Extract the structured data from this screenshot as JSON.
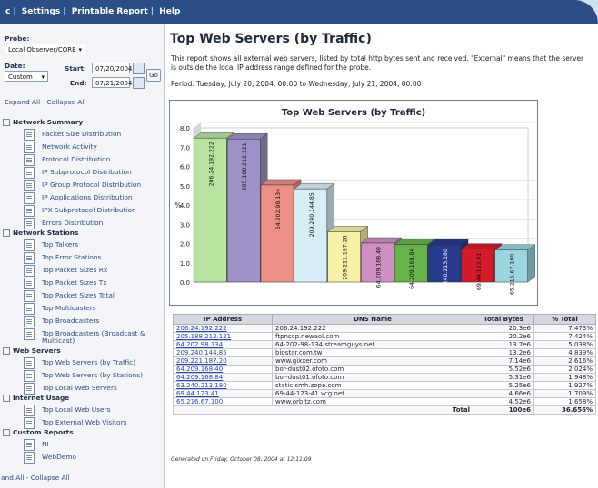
{
  "topbar": {
    "links": [
      "c",
      "Settings",
      "Printable Report",
      "Help"
    ]
  },
  "sidebar": {
    "probe_label": "Probe:",
    "probe_value": "Local Observer/CORE",
    "date_label": "Date:",
    "date_value": "Custom",
    "start_label": "Start:",
    "start_value": "07/20/2004",
    "end_label": "End:",
    "end_value": "07/21/2004",
    "go_label": "Go",
    "expand_collapse": "Expand All - Collapse All",
    "expand_collapse_bottom": "and All - Collapse All",
    "sections": [
      {
        "title": "Network Summary",
        "items": [
          "Packet Size Distribution",
          "Network Activity",
          "Protocol Distribution",
          "IP Subprotocol Distribution",
          "IP Group Protocol Distribution",
          "IP Applications Distribution",
          "IPX Subprotocol Distribution",
          "Errors Distribution"
        ]
      },
      {
        "title": "Network Stations",
        "items": [
          "Top Talkers",
          "Top Error Stations",
          "Top Packet Sizes Rx",
          "Top Packet Sizes Tx",
          "Top Packet Sizes Total",
          "Top Multicasters",
          "Top Broadcasters",
          "Top Broadcasters (Broadcast &",
          "Multicast)"
        ]
      },
      {
        "title": "Web Servers",
        "items": [
          "Top Web Servers (by Traffic)",
          "Top Web Servers (by Stations)",
          "Top Local Web Servers"
        ]
      },
      {
        "title": "Internet Usage",
        "items": [
          "Top Local Web Users",
          "Top External Web Visitors"
        ]
      },
      {
        "title": "Custom Reports",
        "items": [
          "NI",
          "WebDemo"
        ]
      }
    ]
  },
  "main": {
    "title": "Top Web Servers (by Traffic)",
    "desc_line1": "This report shows all external web servers, listed by total http bytes sent and received. \"External\" means that the server",
    "desc_line2": "is outside the local IP address range defined for the probe.",
    "period": "Period: Tuesday, July 20, 2004, 00:00 to Wednesday, July 21, 2004, 00:00",
    "generated": "Generated on Friday, October 08, 2004 at 12:11:09"
  },
  "chart_data": {
    "type": "bar",
    "title": "Top Web Servers (by Traffic)",
    "ylabel": "%",
    "ylim": [
      0,
      8
    ],
    "yticks": [
      "8.0",
      "7.0",
      "6.0",
      "5.0",
      "4.0",
      "3.0",
      "2.0",
      "1.0",
      "0.0"
    ],
    "categories": [
      "206.24.192.222",
      "205.188.212.121",
      "64.202.98.134",
      "209.240.144.85",
      "209.221.187.20",
      "64.209.168.40",
      "64.209.168.84",
      "63.240.213.180",
      "69.44.123.41",
      "65.216.67.100"
    ],
    "values": [
      7.473,
      7.424,
      5.038,
      4.839,
      2.616,
      2.024,
      1.948,
      1.927,
      1.709,
      1.658
    ],
    "colors": [
      "#b7e3a0",
      "#9e92c8",
      "#ee8f86",
      "#d8eef7",
      "#f7f1a8",
      "#cf8fc2",
      "#67b34a",
      "#283a8e",
      "#d51b2a",
      "#9bd6df"
    ],
    "grid": true
  },
  "table": {
    "headers": [
      "IP Address",
      "DNS Name",
      "Total Bytes",
      "% Total"
    ],
    "rows": [
      [
        "206.24.192.222",
        "206.24.192.222",
        "20.3e6",
        "7.473%"
      ],
      [
        "205.188.212.121",
        "ftpnscp.newaol.com",
        "20.2e6",
        "7.424%"
      ],
      [
        "64.202.98.134",
        "64-202-98-134.streamguys.net",
        "13.7e6",
        "5.038%"
      ],
      [
        "209.240.144.85",
        "biostar.com.tw",
        "13.2e6",
        "4.839%"
      ],
      [
        "209.221.187.20",
        "www.gixxer.com",
        "7.14e6",
        "2.616%"
      ],
      [
        "64.209.168.40",
        "bor-dust02.ofoto.com",
        "5.52e6",
        "2.024%"
      ],
      [
        "64.209.168.84",
        "bor-dust01.ofoto.com",
        "5.31e6",
        "1.948%"
      ],
      [
        "63.240.213.180",
        "static.smh.zope.com",
        "5.25e6",
        "1.927%"
      ],
      [
        "69.44.123.41",
        "69-44-123-41.vcg.net",
        "4.66e6",
        "1.709%"
      ],
      [
        "65.216.67.100",
        "www.orbitz.com",
        "4.52e6",
        "1.658%"
      ]
    ],
    "total_label": "Total",
    "total_bytes": "100e6",
    "total_pct": "36.656%"
  }
}
